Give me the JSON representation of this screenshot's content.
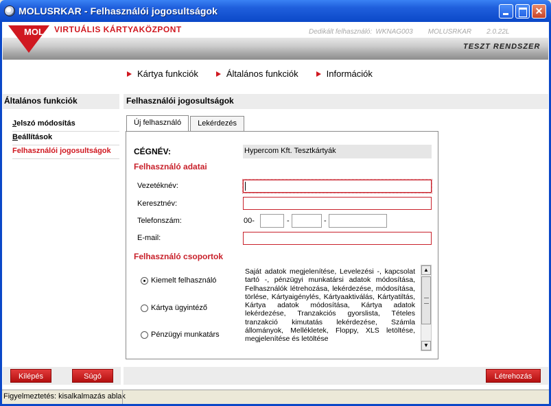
{
  "window": {
    "title": "MOLUSRKAR - Felhasználói jogosultságok"
  },
  "header": {
    "brand": "VIRTUÁLIS KÁRTYAKÖZPONT",
    "dedicated_user_label": "Dedikált felhasználó:",
    "dedicated_user_value": "WKNAG003",
    "user_code": "MOLUSRKAR",
    "version": "2.0.22L",
    "test_system": "TESZT RENDSZER",
    "logo_text": "MOL"
  },
  "topnav": {
    "items": [
      {
        "label": "Kártya funkciók"
      },
      {
        "label": "Általános funkciók"
      },
      {
        "label": "Információk"
      }
    ]
  },
  "sidebar": {
    "title": "Általános funkciók",
    "items": [
      {
        "first": "J",
        "rest": "elszó módosítás"
      },
      {
        "first": "B",
        "rest": "eállítások"
      },
      {
        "first": "",
        "rest": "Felhasználói jogosultságok"
      }
    ]
  },
  "main": {
    "title": "Felhasználói jogosultságok",
    "tabs": [
      {
        "label": "Új felhasználó"
      },
      {
        "label": "Lekérdezés"
      }
    ],
    "company_label": "CÉGNÉV:",
    "company_value": "Hypercom Kft. Tesztkártyák",
    "user_data_title": "Felhasználó adatai",
    "fields": {
      "lastname_label": "Vezetéknév:",
      "firstname_label": "Keresztnév:",
      "phone_label": "Telefonszám:",
      "phone_prefix": "00-",
      "phone_sep": "-",
      "email_label": "E-mail:"
    },
    "groups_title": "Felhasználó csoportok",
    "groups": [
      {
        "label": "Kiemelt felhasználó",
        "selected": true
      },
      {
        "label": "Kártya ügyintéző",
        "selected": false
      },
      {
        "label": "Pénzügyi munkatárs",
        "selected": false
      }
    ],
    "group_description": "Saját adatok megjelenítése, Levelezési -, kapcsolat tartó -, pénzügyi munkatársi adatok módosítása, Felhasználók létrehozása, lekérdezése, módosítása, törlése, Kártyaigénylés, Kártyaaktiválás, Kártyatiltás, Kártya adatok módosítása, Kártya adatok lekérdezése, Tranzakciós gyorslista, Tételes tranzakció kimutatás lekérdezése, Számla állományok, Mellékletek, Floppy, XLS letöltése, megjelenítése és letöltése"
  },
  "buttons": {
    "exit": "Kilépés",
    "help": "Súgó",
    "create": "Létrehozás"
  },
  "status": {
    "text": "Figyelmeztetés: kisalkalmazás ablak"
  },
  "colors": {
    "accent": "#d01820",
    "titlebar": "#0b48c8"
  }
}
